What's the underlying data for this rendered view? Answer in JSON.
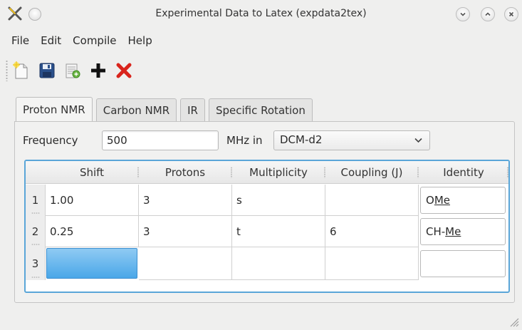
{
  "window": {
    "title": "Experimental Data to Latex (expdata2tex)",
    "logo_icon": "kde-x-logo-icon",
    "controls": [
      "minimize-icon",
      "maximize-icon",
      "close-icon"
    ]
  },
  "menubar": {
    "items": [
      {
        "label": "File"
      },
      {
        "label": "Edit"
      },
      {
        "label": "Compile"
      },
      {
        "label": "Help"
      }
    ]
  },
  "toolbar": {
    "buttons": [
      {
        "icon": "new-document-icon"
      },
      {
        "icon": "save-icon"
      },
      {
        "icon": "export-icon"
      },
      {
        "icon": "add-icon"
      },
      {
        "icon": "delete-icon"
      }
    ]
  },
  "tabs": [
    {
      "label": "Proton NMR",
      "active": true
    },
    {
      "label": "Carbon NMR",
      "active": false
    },
    {
      "label": "IR",
      "active": false
    },
    {
      "label": "Specific Rotation",
      "active": false
    }
  ],
  "form": {
    "frequency_label": "Frequency",
    "frequency_value": "500",
    "unit_label": "MHz in",
    "solvent_value": "DCM-d2"
  },
  "table": {
    "columns": [
      "Shift",
      "Protons",
      "Multiplicity",
      "Coupling (J)",
      "Identity"
    ],
    "rows": [
      {
        "num": "1",
        "shift": "1.00",
        "protons": "3",
        "multiplicity": "s",
        "coupling": "",
        "identity_prefix": "O",
        "identity_underlined": "Me"
      },
      {
        "num": "2",
        "shift": "0.25",
        "protons": "3",
        "multiplicity": "t",
        "coupling": "6",
        "identity_prefix": "CH-",
        "identity_underlined": "Me"
      },
      {
        "num": "3",
        "shift": "",
        "protons": "",
        "multiplicity": "",
        "coupling": "",
        "identity_prefix": "",
        "identity_underlined": ""
      }
    ]
  },
  "colors": {
    "accent": "#5aa6d8",
    "selection": "#4aa7e8",
    "delete": "#d9241c",
    "save": "#2a4f8a"
  }
}
